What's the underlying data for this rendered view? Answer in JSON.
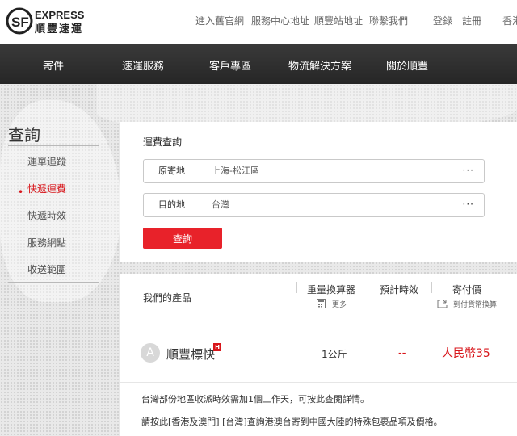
{
  "header": {
    "logo_text_top": "EXPRESS",
    "logo_text_bottom": "順豐速運",
    "links": [
      "進入舊官網",
      "服務中心地址",
      "順豐站地址",
      "聯繫我們",
      "登錄",
      "註冊",
      "香港"
    ]
  },
  "nav": {
    "items": [
      "寄件",
      "速運服務",
      "客戶專區",
      "物流解決方案",
      "關於順豐"
    ]
  },
  "sidebar": {
    "title": "查詢",
    "items": [
      {
        "label": "運單追蹤",
        "active": false
      },
      {
        "label": "快遞運費",
        "active": true
      },
      {
        "label": "快遞時效",
        "active": false
      },
      {
        "label": "服務網點",
        "active": false
      },
      {
        "label": "收送範圍",
        "active": false
      }
    ],
    "bullet": "•"
  },
  "query": {
    "title": "運費查詢",
    "origin": {
      "label": "原寄地",
      "value": "上海-松江區",
      "more": "···"
    },
    "destination": {
      "label": "目的地",
      "value": "台灣",
      "more": "···"
    },
    "button": "查詢"
  },
  "results": {
    "products_label": "我們的產品",
    "columns": [
      {
        "title": "重量換算器",
        "sub": "更多"
      },
      {
        "title": "預計時效",
        "sub": ""
      },
      {
        "title": "寄付價",
        "sub": "到付貨幣換算"
      }
    ],
    "rows": [
      {
        "avatar": "A",
        "name": "順豐標快",
        "badge": "H",
        "weight": "1公斤",
        "eta": "--",
        "price": "人民幣35"
      }
    ],
    "notes": {
      "line1_pre": "台灣部份地區收派時效需加1個工作天，可",
      "line1_link": "按此",
      "line1_post": "查閱詳情。",
      "line2_pre": "請",
      "line2_link1": "按此",
      "line2_link2": "[香港及澳門]",
      "line2_link3": "[台灣]",
      "line2_post": "查詢港澳台寄到中國大陸的特殊包裹品項及價格。"
    }
  },
  "colors": {
    "accent_red": "#e8222a",
    "nav_bg": "#2b2b2b",
    "price_red": "#d8161b"
  }
}
